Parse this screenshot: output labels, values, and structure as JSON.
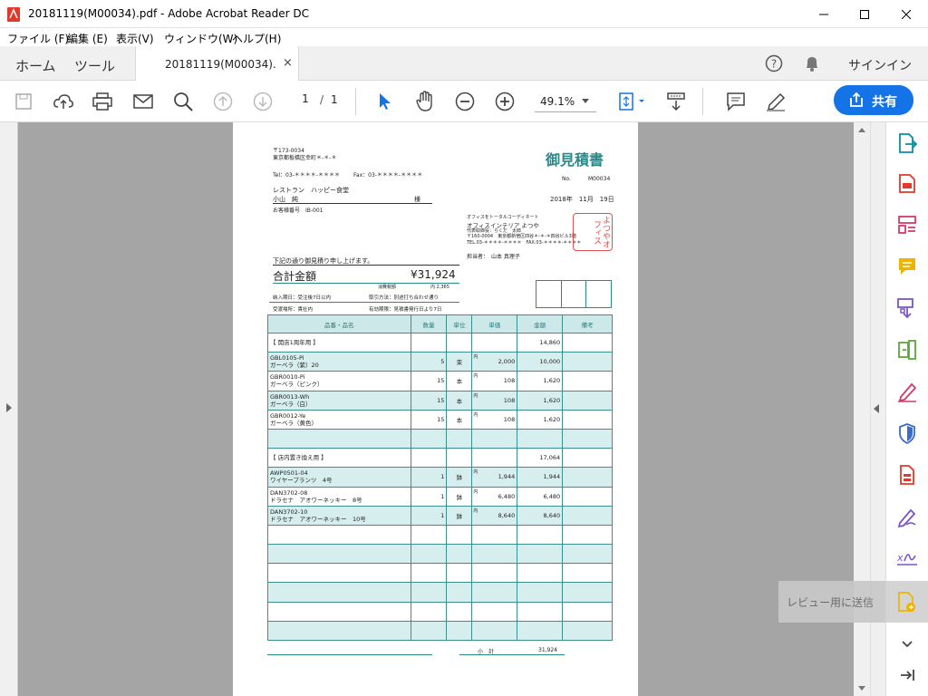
{
  "window": {
    "title": "20181119(M00034).pdf - Adobe Acrobat Reader DC"
  },
  "menu": [
    "ファイル (F)",
    "編集 (E)",
    "表示(V)",
    "ウィンドウ(W)",
    "ヘルプ(H)"
  ],
  "tabs": {
    "home": "ホーム",
    "tools": "ツール",
    "doc": "20181119(M00034).",
    "close": "×"
  },
  "header": {
    "signin": "サインイン"
  },
  "toolbar": {
    "page_current": "1",
    "page_sep": "/",
    "page_total": "1",
    "zoom": "49.1%",
    "share": "共有"
  },
  "tooltip": "レビュー用に送信",
  "colors": {
    "accent": "#1473e6",
    "teal": "#2a8a8a",
    "stamp": "#e05050"
  },
  "doc": {
    "postal": "〒173-0034",
    "address": "東京都板橋区幸町＊-＊-＊",
    "tel": "Tel：03-＊＊＊＊-＊＊＊＊",
    "fax": "Fax：03-＊＊＊＊-＊＊＊＊",
    "title": "御見積書",
    "no_label": "No.",
    "no_value": "M00034",
    "customer": "レストラン　ハッピー食堂",
    "contact": "小山　純",
    "honorific": "様",
    "date": "2018年　11月　19日",
    "custno": "お客様番号　IB-001",
    "vendor_tag": "オフィスをトータルコーディネート",
    "vendor_name": "オフィスインテリア よつや",
    "vendor_rep": "代表取締役：らくだ　太郎",
    "vendor_addr": "〒160-0004　東京都新宿区四谷＊-＊-＊四谷ビル3階",
    "vendor_tel": "TEL.03-＊＊＊＊-＊＊＊＊　FAX.03-＊＊＊＊-＊＊＊＊",
    "stamp": "よつやオフィス",
    "staff": "担当者：　山本 真理子",
    "intro": "下記の通り御見積り申し上げます。",
    "total_label": "合計金額",
    "total_value": "¥31,924",
    "tax_label": "消費税額",
    "tax_value": "内 2,365",
    "term1": "納入期日：受注後7日以内",
    "term2": "取引方法：別途打ち合わせ通り",
    "term3": "受渡場所：貴社内",
    "term4": "有効期限：見積書発行日より7日",
    "columns": [
      "品番・品名",
      "数量",
      "単位",
      "単価",
      "金額",
      "備考"
    ],
    "rows": [
      {
        "code": "",
        "name": "【 開店1周年用 】",
        "qty": "",
        "unit": "",
        "price": "",
        "amount": "14,860"
      },
      {
        "code": "GBL0105-Pi",
        "name": "ガーベラ（紫）20",
        "qty": "5",
        "unit": "束",
        "price": "2,000",
        "amount": "10,000"
      },
      {
        "code": "GBR0010-Pi",
        "name": "ガーベラ（ピンク）",
        "qty": "15",
        "unit": "本",
        "price": "108",
        "amount": "1,620"
      },
      {
        "code": "GBR0013-Wh",
        "name": "ガーベラ（白）",
        "qty": "15",
        "unit": "本",
        "price": "108",
        "amount": "1,620"
      },
      {
        "code": "GBR0012-Ye",
        "name": "ガーベラ（黄色）",
        "qty": "15",
        "unit": "本",
        "price": "108",
        "amount": "1,620"
      },
      {
        "code": "",
        "name": "",
        "qty": "",
        "unit": "",
        "price": "",
        "amount": ""
      },
      {
        "code": "",
        "name": "【 店内置き換え用 】",
        "qty": "",
        "unit": "",
        "price": "",
        "amount": "17,064"
      },
      {
        "code": "AWP0501-04",
        "name": "ワイヤープランツ　4号",
        "qty": "1",
        "unit": "鉢",
        "price": "1,944",
        "amount": "1,944"
      },
      {
        "code": "DAN3702-08",
        "name": "ドラセナ　アオワーネッキー　8号",
        "qty": "1",
        "unit": "鉢",
        "price": "6,480",
        "amount": "6,480"
      },
      {
        "code": "DAN3702-10",
        "name": "ドラセナ　アオワーネッキー　10号",
        "qty": "1",
        "unit": "鉢",
        "price": "8,640",
        "amount": "8,640"
      },
      {
        "code": "",
        "name": "",
        "qty": "",
        "unit": "",
        "price": "",
        "amount": ""
      },
      {
        "code": "",
        "name": "",
        "qty": "",
        "unit": "",
        "price": "",
        "amount": ""
      },
      {
        "code": "",
        "name": "",
        "qty": "",
        "unit": "",
        "price": "",
        "amount": ""
      },
      {
        "code": "",
        "name": "",
        "qty": "",
        "unit": "",
        "price": "",
        "amount": ""
      },
      {
        "code": "",
        "name": "",
        "qty": "",
        "unit": "",
        "price": "",
        "amount": ""
      },
      {
        "code": "",
        "name": "",
        "qty": "",
        "unit": "",
        "price": "",
        "amount": ""
      }
    ],
    "price_prefix": "内",
    "subtotal_label": "小　計",
    "subtotal_value": "31,924"
  }
}
